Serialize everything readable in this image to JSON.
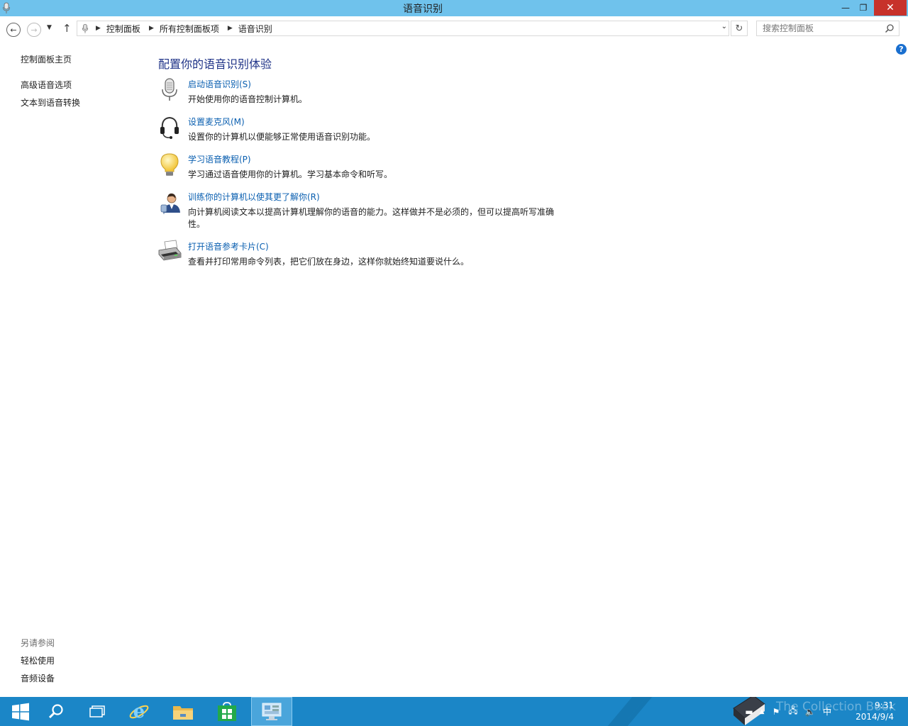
{
  "window": {
    "title": "语音识别",
    "min_glyph": "—",
    "max_glyph": "❐",
    "close_glyph": "✕"
  },
  "nav": {
    "breadcrumbs": [
      "控制面板",
      "所有控制面板项",
      "语音识别"
    ],
    "search_placeholder": "搜索控制面板"
  },
  "sidebar": {
    "home": "控制面板主页",
    "links": [
      "高级语音选项",
      "文本到语音转换"
    ],
    "see_also_title": "另请参阅",
    "see_also": [
      "轻松使用",
      "音频设备"
    ]
  },
  "main": {
    "heading": "配置你的语音识别体验",
    "tasks": [
      {
        "icon": "microphone-icon",
        "link": "启动语音识别(S)",
        "desc": "开始使用你的语音控制计算机。"
      },
      {
        "icon": "headset-icon",
        "link": "设置麦克风(M)",
        "desc": "设置你的计算机以便能够正常使用语音识别功能。"
      },
      {
        "icon": "lightbulb-icon",
        "link": "学习语音教程(P)",
        "desc": "学习通过语音使用你的计算机。学习基本命令和听写。"
      },
      {
        "icon": "user-training-icon",
        "link": "训练你的计算机以使其更了解你(R)",
        "desc": "向计算机阅读文本以提高计算机理解你的语音的能力。这样做并不是必须的，但可以提高听写准确性。"
      },
      {
        "icon": "printer-icon",
        "link": "打开语音参考卡片(C)",
        "desc": "查看并打印常用命令列表，把它们放在身边，这样你就始终知道要说什么。"
      }
    ]
  },
  "taskbar": {
    "ime": "中",
    "time": "9:31",
    "date": "2014/9/4",
    "watermark": "The Collection Book"
  },
  "colors": {
    "titlebar": "#6fc2ec",
    "taskbar": "#1b86c7",
    "link": "#0a5fb0",
    "heading": "#1e3287",
    "close": "#c7322b"
  }
}
